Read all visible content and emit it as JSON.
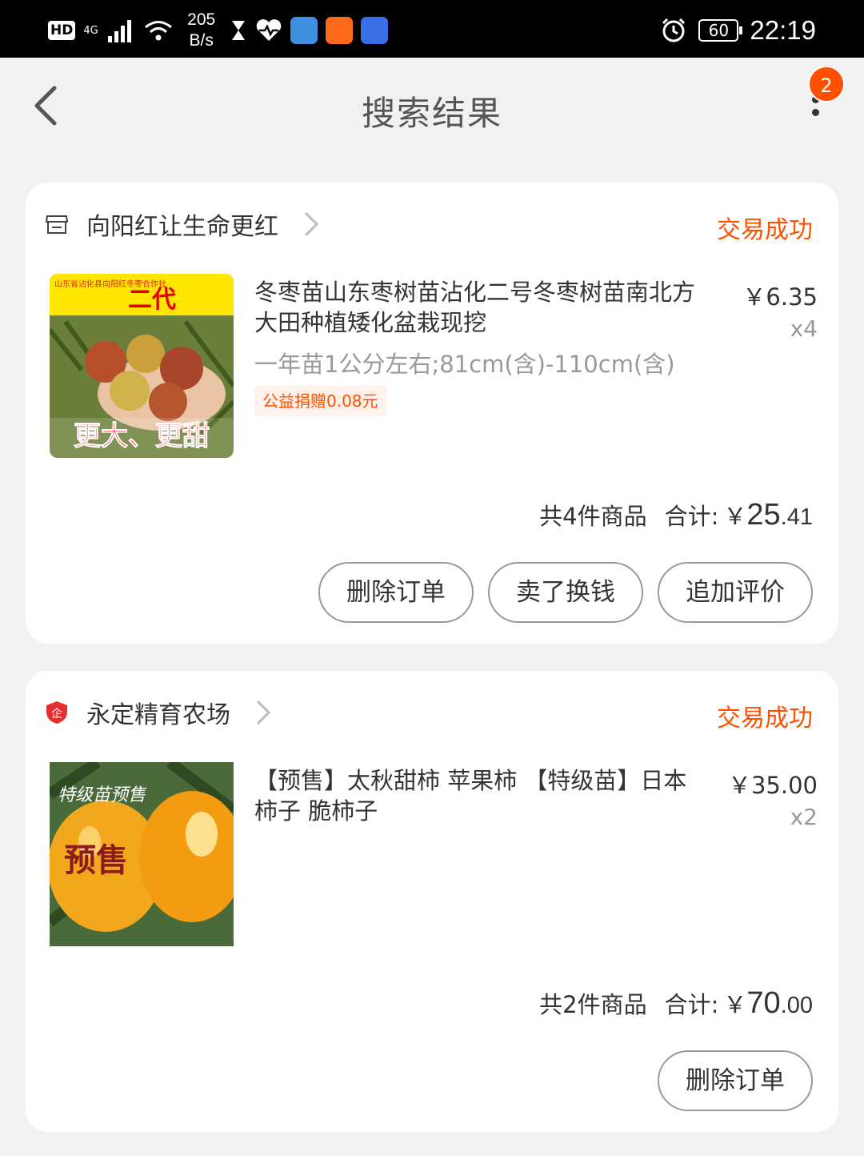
{
  "status_bar": {
    "hd": "HD",
    "network": "4G",
    "speed_value": "205",
    "speed_unit": "B/s",
    "battery": "60",
    "time": "22:19"
  },
  "header": {
    "title": "搜索结果",
    "badge_count": "2"
  },
  "orders": [
    {
      "shop_name": "向阳红让生命更红",
      "shop_icon": "store-icon",
      "status": "交易成功",
      "item_title": "冬枣苗山东枣树苗沾化二号冬枣树苗南北方大田种植矮化盆栽现挖",
      "item_sku": "一年苗1公分左右;81cm(含)-110cm(含)",
      "charity": "公益捐赠0.08元",
      "price": "￥6.35",
      "qty": "x4",
      "count_text": "共4件商品",
      "total_label": "合计:",
      "currency": "￥",
      "total_int": "25",
      "total_dec": ".41",
      "thumb_text_top": "山东省沾化县向阳红冬枣合作社",
      "thumb_text_gen": "二代",
      "thumb_text_bottom": "更大、更甜",
      "buttons": [
        "删除订单",
        "卖了换钱",
        "追加评价"
      ]
    },
    {
      "shop_name": "永定精育农场",
      "shop_icon": "enterprise-shield-icon",
      "shop_icon_text": "企",
      "status": "交易成功",
      "item_title": "【预售】太秋甜柿 苹果柿 【特级苗】日本柿子 脆柿子",
      "price": "￥35.00",
      "qty": "x2",
      "count_text": "共2件商品",
      "total_label": "合计:",
      "currency": "￥",
      "total_int": "70",
      "total_dec": ".00",
      "thumb_text_top": "特级苗预售",
      "thumb_text_main": "预售",
      "buttons": [
        "删除订单"
      ]
    }
  ],
  "colors": {
    "accent": "#ff5000",
    "background": "#f1f1f1"
  }
}
